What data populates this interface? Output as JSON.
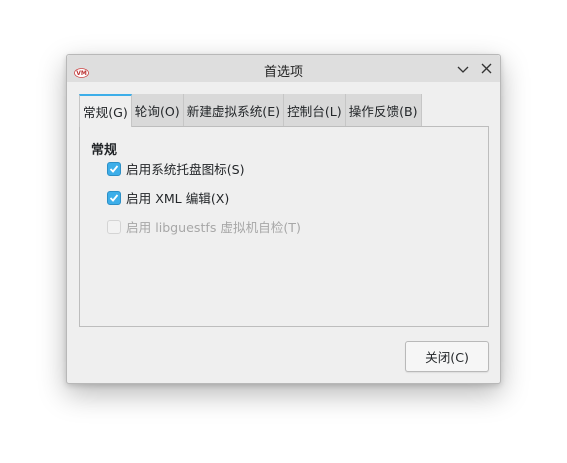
{
  "window": {
    "title": "首选项",
    "app_icon": "virt-manager-icon",
    "controls": {
      "minimize_icon": "chevron-down-icon",
      "close_icon": "close-icon"
    }
  },
  "tabs": [
    {
      "label": "常规(G)",
      "active": true
    },
    {
      "label": "轮询(O)",
      "active": false
    },
    {
      "label": "新建虚拟系统(E)",
      "active": false
    },
    {
      "label": "控制台(L)",
      "active": false
    },
    {
      "label": "操作反馈(B)",
      "active": false
    }
  ],
  "general": {
    "section_title": "常规",
    "options": [
      {
        "label": "启用系统托盘图标(S)",
        "checked": true,
        "enabled": true
      },
      {
        "label": "启用 XML 编辑(X)",
        "checked": true,
        "enabled": true
      },
      {
        "label": "启用 libguestfs 虚拟机自检(T)",
        "checked": false,
        "enabled": false
      }
    ]
  },
  "footer": {
    "close_label": "关闭(C)"
  },
  "colors": {
    "accent": "#3daee9",
    "window_bg": "#efefef",
    "titlebar_bg": "#dedede",
    "disabled_text": "#a7a7a7"
  }
}
